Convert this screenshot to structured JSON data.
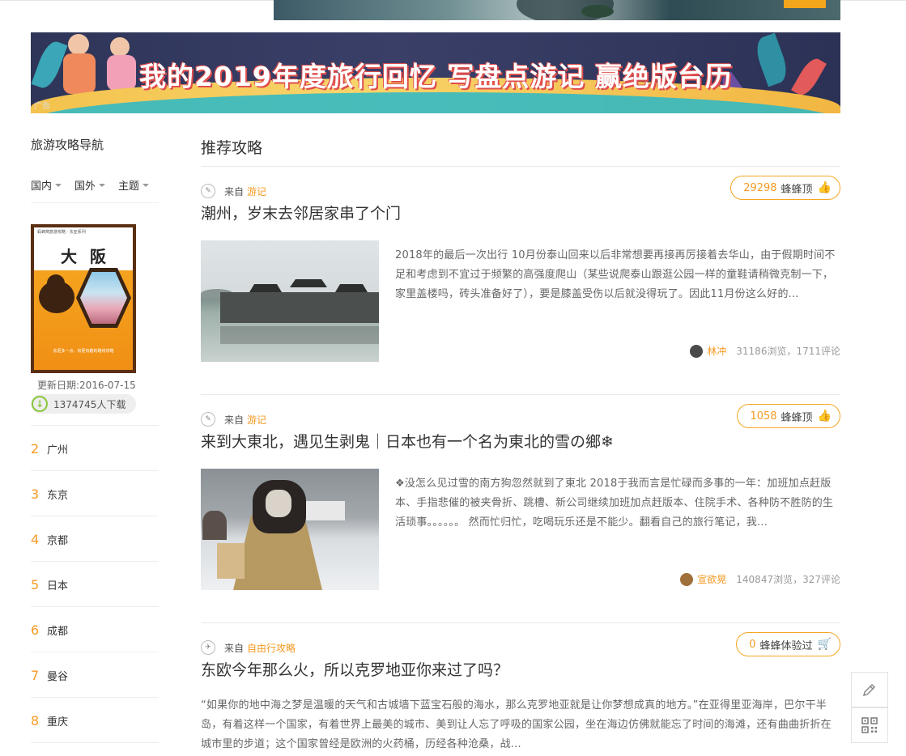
{
  "top_ad": {
    "image": "landscape-ad-strip"
  },
  "banner": {
    "title": "我的2019年度旅行回忆  写盘点游记 赢绝版台历",
    "ad_tag": "广告"
  },
  "sidebar": {
    "title": "旅游攻略导航",
    "tabs": [
      {
        "label": "国内"
      },
      {
        "label": "国外"
      },
      {
        "label": "主题"
      }
    ],
    "guide": {
      "series": "蚂蜂窝旅游攻略 · 东亚系列",
      "city": "大阪",
      "slogan": "去更多一点，有更有趣的路线攻略",
      "update_date": "更新日期:2016-07-15",
      "downloads": "1374745人下载"
    },
    "cities": [
      {
        "rank": "2",
        "name": "广州"
      },
      {
        "rank": "3",
        "name": "东京"
      },
      {
        "rank": "4",
        "name": "京都"
      },
      {
        "rank": "5",
        "name": "日本"
      },
      {
        "rank": "6",
        "name": "成都"
      },
      {
        "rank": "7",
        "name": "曼谷"
      },
      {
        "rank": "8",
        "name": "重庆"
      }
    ]
  },
  "main": {
    "title": "推荐攻略",
    "posts": [
      {
        "from_label": "来自",
        "source": "游记",
        "vote_count": "29298",
        "vote_label": "蜂蜂顶",
        "title": "潮州，岁末去邻居家串了个门",
        "excerpt": "2018年的最后一次出行 10月份泰山回来以后非常想要再接再厉接着去华山，由于假期时间不足和考虑到不宜过于频繁的高强度爬山（某些说爬泰山跟逛公园一样的童鞋请稍微克制一下，家里盖楼吗，砖头准备好了），要是膝盖受伤以后就没得玩了。因此11月份这么好的...",
        "author": "林冲",
        "stats": "31186浏览，1711评论"
      },
      {
        "from_label": "来自",
        "source": "游记",
        "vote_count": "1058",
        "vote_label": "蜂蜂顶",
        "title": "来到大東北，遇见生剥鬼｜日本也有一个名为東北的雪の鄉❄",
        "excerpt": "❖没怎么见过雪的南方狗忽然就到了東北 2018于我而言是忙碌而多事的一年：加班加点赶版本、手指悲催的被夹骨折、跳槽、新公司继续加班加点赶版本、住院手术、各种防不胜防的生活琐事。。。。。。 然而忙归忙，吃喝玩乐还是不能少。翻看自己的旅行笔记，我...",
        "author": "宣欲晃",
        "stats": "140847浏览，327评论"
      },
      {
        "from_label": "来自",
        "source": "自由行攻略",
        "vote_count": "0",
        "vote_label": "蜂蜂体验过",
        "title": "东欧今年那么火，所以克罗地亚你来过了吗？",
        "excerpt": "“如果你的地中海之梦是温暖的天气和古城墙下蓝宝石般的海水，那么克罗地亚就是让你梦想成真的地方。”在亚得里亚海岸，巴尔干半岛，有着这样一个国家，有着世界上最美的城市、美到让人忘了呼吸的国家公园，坐在海边仿佛就能忘了时间的海滩，还有曲曲折折在城市里的步道；这个国家曾经是欧洲的火药桶，历经各种沧桑，战..."
      }
    ]
  },
  "tools": [
    {
      "icon": "pencil-icon"
    },
    {
      "icon": "qrcode-icon"
    }
  ],
  "colors": {
    "accent": "#f59a23",
    "green": "#8cc63f"
  }
}
